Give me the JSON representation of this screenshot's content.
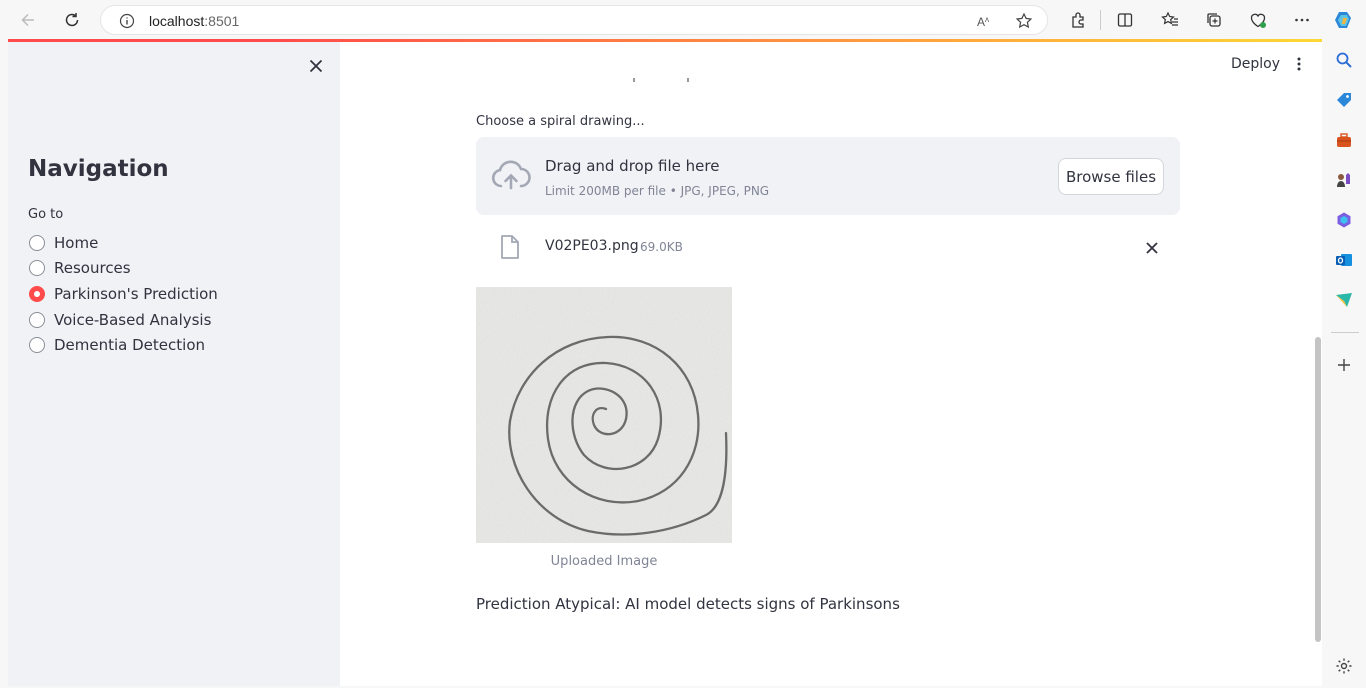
{
  "browser": {
    "url_host": "localhost",
    "url_port": ":8501"
  },
  "sidebar": {
    "title": "Navigation",
    "radio_label": "Go to",
    "items": [
      {
        "label": "Home",
        "selected": false
      },
      {
        "label": "Resources",
        "selected": false
      },
      {
        "label": "Parkinson's Prediction",
        "selected": true
      },
      {
        "label": "Voice-Based Analysis",
        "selected": false
      },
      {
        "label": "Dementia Detection",
        "selected": false
      }
    ]
  },
  "header": {
    "deploy_label": "Deploy"
  },
  "uploader": {
    "label": "Choose a spiral drawing...",
    "drop_text": "Drag and drop file here",
    "limit_text": "Limit 200MB per file • JPG, JPEG, PNG",
    "browse_label": "Browse files"
  },
  "file": {
    "name": "V02PE03.png",
    "size": "69.0KB"
  },
  "image": {
    "caption": "Uploaded Image"
  },
  "result": {
    "text": "Prediction Atypical: AI model detects signs of Parkinsons"
  },
  "colors": {
    "accent": "#ff4b4b",
    "sidebar_bg": "#f0f2f6",
    "text": "#31333f",
    "muted": "#808495"
  }
}
